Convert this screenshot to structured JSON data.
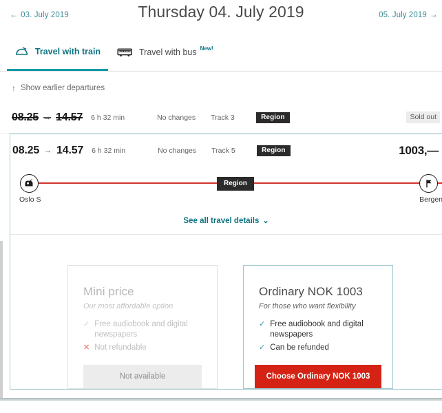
{
  "header": {
    "prev_date": "03. July 2019",
    "prev_arrow": "←",
    "title": "Thursday 04. July 2019",
    "next_date": "05. July 2019",
    "next_arrow": "→"
  },
  "tabs": [
    {
      "label": "Travel with train",
      "icon": "train-icon",
      "selected": true,
      "badge": ""
    },
    {
      "label": "Travel with bus",
      "icon": "bus-icon",
      "selected": false,
      "badge": "New!"
    }
  ],
  "earlier": {
    "label": "Show earlier departures",
    "arrow": "↑"
  },
  "departures": [
    {
      "depart": "08.25",
      "arrive": "14.57",
      "arrow": "→",
      "duration": "6 h 32 min",
      "changes": "No changes",
      "track": "Track 3",
      "operator": "Region",
      "status": "Sold out",
      "price": "",
      "sold_out": true,
      "selected": false
    },
    {
      "depart": "08.25",
      "arrive": "14.57",
      "arrow": "→",
      "duration": "6 h 32 min",
      "changes": "No changes",
      "track": "Track 5",
      "operator": "Region",
      "status": "",
      "price": "1003,—",
      "sold_out": false,
      "selected": true
    }
  ],
  "route": {
    "origin": "Oslo S",
    "destination": "Bergen",
    "origin_icon": "train-front-icon",
    "destination_icon": "flag-icon",
    "segment_label": "Region",
    "line_color": "#d0342c"
  },
  "details_link": {
    "label": "See all travel details",
    "chevron": "⌄"
  },
  "ticket_cards": [
    {
      "title": "Mini price",
      "subtitle": "Our most affordable option",
      "features": [
        {
          "mark": "✓",
          "text": "Free audiobook and digital newspapers",
          "ok": true
        },
        {
          "mark": "✕",
          "text": "Not refundable",
          "ok": false
        }
      ],
      "cta": "Not available",
      "selected": false
    },
    {
      "title": "Ordinary NOK 1003",
      "subtitle": "For those who want flexibility",
      "features": [
        {
          "mark": "✓",
          "text": "Free audiobook and digital newspapers",
          "ok": true
        },
        {
          "mark": "✓",
          "text": "Can be refunded",
          "ok": true
        }
      ],
      "cta": "Choose Ordinary NOK 1003",
      "selected": true
    }
  ],
  "colors": {
    "accent_teal": "#009aa6",
    "link_teal": "#0d7380",
    "cta_red": "#d42314",
    "route_red": "#d0342c",
    "badge_dark": "#2b2b2b"
  }
}
